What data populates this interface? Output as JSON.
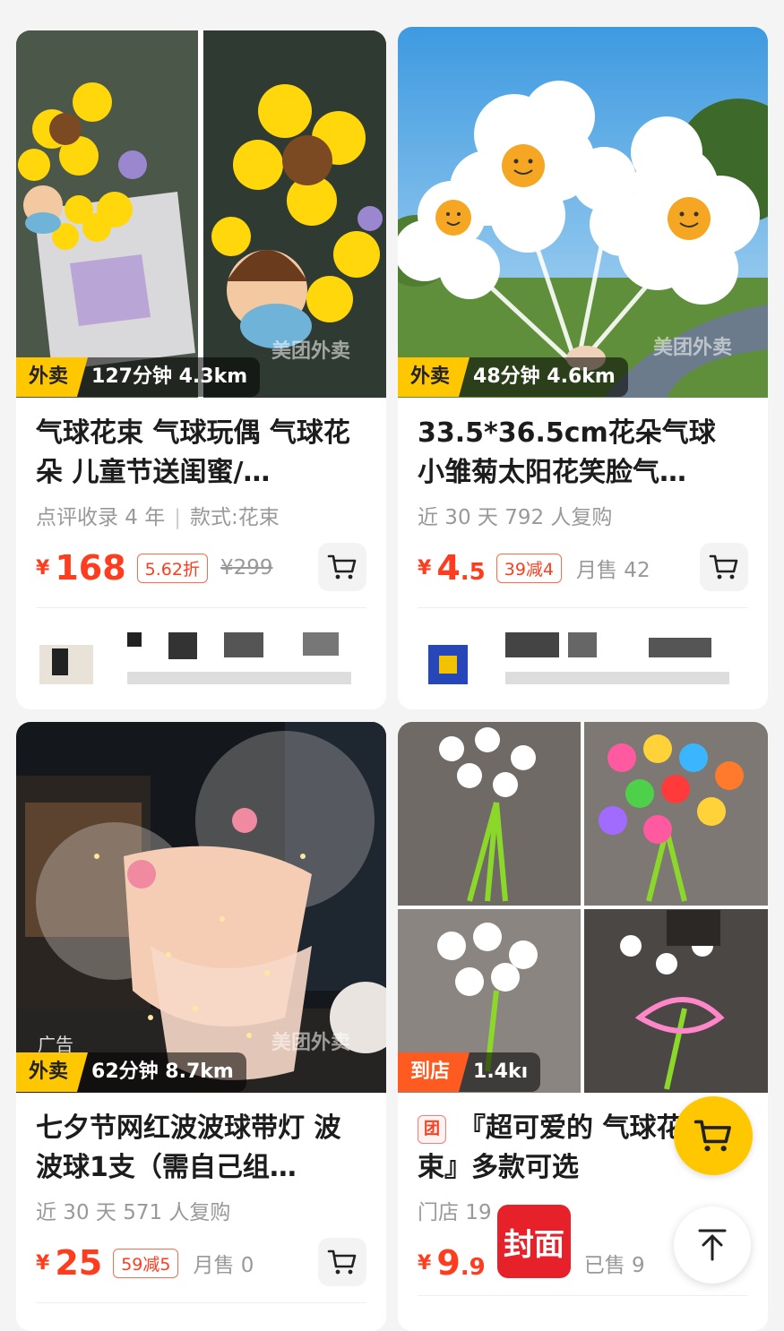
{
  "products": [
    {
      "tag": "外卖",
      "meta": "127分钟  4.3km",
      "image_watermark": "美团外卖",
      "title": "气球花束 气球玩偶 气球花朵 儿童节送闺蜜/…",
      "sub_left": "点评收录 4 年",
      "sub_right": "款式:花束",
      "yen": "¥",
      "price": "168",
      "promo": "5.62折",
      "original_price": "¥299"
    },
    {
      "tag": "外卖",
      "meta": "48分钟  4.6km",
      "image_watermark": "美团外卖",
      "title": "33.5*36.5cm花朵气球 小雏菊太阳花笑脸气…",
      "sub_left": "近 30 天 792 人复购",
      "yen": "¥",
      "price_int": "4",
      "price_dec": ".5",
      "promo": "39减4",
      "sold": "月售 42"
    },
    {
      "tag": "外卖",
      "meta": "62分钟  8.7km",
      "image_watermark": "美团外卖",
      "ad": "广告",
      "title": "七夕节网红波波球带灯 波波球1支（需自己组…",
      "sub_left": "近 30 天 571 人复购",
      "yen": "¥",
      "price": "25",
      "promo": "59减5",
      "sold": "月售 0"
    },
    {
      "tag": "到店",
      "meta": "1.4kı",
      "title_badge": "团",
      "title": "『超可爱的 气球花束』多款可选",
      "sub_left": "门店 19",
      "yen": "¥",
      "price_int": "9",
      "price_dec": ".9",
      "sold": "已售 9"
    }
  ],
  "overlay": {
    "watermark_text": "封面"
  },
  "icons": {
    "cart": "shopping-cart-icon",
    "back_to_top": "back-to-top-icon"
  },
  "colors": {
    "accent_yellow": "#ffc700",
    "price_red": "#ff3c1e",
    "instore_orange": "#ff5a1f"
  }
}
